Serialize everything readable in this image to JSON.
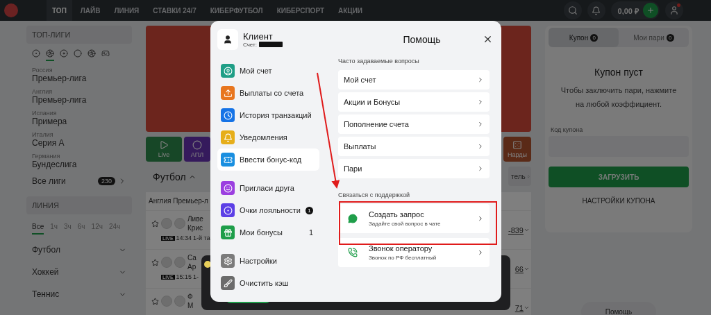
{
  "nav": {
    "items": [
      {
        "label": "ТОП",
        "selected": true
      },
      {
        "label": "ЛАЙВ",
        "selected": false
      },
      {
        "label": "ЛИНИЯ",
        "selected": false
      },
      {
        "label": "СТАВКИ 24/7",
        "selected": false
      },
      {
        "label": "КИБЕРФУТБОЛ",
        "selected": false
      },
      {
        "label": "КИБЕРСПОРТ",
        "selected": false
      },
      {
        "label": "АКЦИИ",
        "selected": false
      }
    ],
    "balance": "0,00 ₽"
  },
  "sidebar": {
    "top_leagues": {
      "title": "ТОП-ЛИГИ",
      "sports": [
        {
          "selected": false
        },
        {
          "selected": true
        },
        {
          "selected": false
        },
        {
          "selected": false
        },
        {
          "selected": false
        },
        {
          "selected": false
        }
      ],
      "leagues": [
        {
          "country": "Россия",
          "name": "Премьер-лига"
        },
        {
          "country": "Англия",
          "name": "Премьер-лига"
        },
        {
          "country": "Испания",
          "name": "Примера"
        },
        {
          "country": "Италия",
          "name": "Серия А"
        },
        {
          "country": "Германия",
          "name": "Бундеслига"
        }
      ],
      "all_leagues": {
        "label": "Все лиги",
        "count": "230"
      }
    },
    "line": {
      "title": "ЛИНИЯ",
      "periods": [
        {
          "label": "Все",
          "selected": true
        },
        {
          "label": "1ч",
          "selected": false
        },
        {
          "label": "3ч",
          "selected": false
        },
        {
          "label": "6ч",
          "selected": false
        },
        {
          "label": "12ч",
          "selected": false
        },
        {
          "label": "24ч",
          "selected": false
        }
      ],
      "sports": [
        "Футбол",
        "Хоккей",
        "Теннис"
      ]
    }
  },
  "center": {
    "tiles": [
      {
        "label": "Live"
      },
      {
        "label": "АПЛ"
      }
    ],
    "right_tile": "Нарды",
    "section_title": "Футбол",
    "league": "Англия Премьер-л",
    "sort": "тель",
    "matches": [
      {
        "team_1": "Ливе",
        "team_2": "Крис",
        "live": "LIVE",
        "time": "14:34",
        "status": "1-й та",
        "odds": "-839"
      },
      {
        "team_1": "Са",
        "team_2": "Ар",
        "live": "LIVE",
        "time": "15:15",
        "status": "1-",
        "odds": "66"
      },
      {
        "team_1": "Ф",
        "team_2": "М",
        "odds": "71"
      }
    ]
  },
  "coupon": {
    "tabs": [
      {
        "label": "Купон",
        "count": "0",
        "selected": true
      },
      {
        "label": "Мои пари",
        "count": "0",
        "selected": false
      }
    ],
    "empty_title": "Купон пуст",
    "empty_text": "Чтобы заключить пари, нажмите на любой коэффициент.",
    "code_label": "Код купона",
    "load_button": "ЗАГРУЗИТЬ",
    "settings_link": "НАСТРОЙКИ КУПОНА",
    "help_button": "Помощь"
  },
  "modal": {
    "user": {
      "name": "Клиент",
      "account_label": "Счет:"
    },
    "title": "Помощь",
    "menu_groups": [
      [
        {
          "label": "Мой счет",
          "color": "#1f9e86",
          "selected": false
        },
        {
          "label": "Выплаты со счета",
          "color": "#e8761f",
          "selected": false
        },
        {
          "label": "История транзакций",
          "color": "#1673e6",
          "selected": false
        },
        {
          "label": "Уведомления",
          "color": "#e6ae1a",
          "selected": false
        },
        {
          "label": "Ввести бонус-код",
          "color": "#1a8fe0",
          "selected": true
        }
      ],
      [
        {
          "label": "Пригласи друга",
          "color": "#9b3fe0",
          "selected": false
        },
        {
          "label": "Очки лояльности",
          "color": "#5b3fe6",
          "selected": false,
          "badge": "1"
        },
        {
          "label": "Мои бонусы",
          "color": "#1e9e4a",
          "selected": false,
          "count": "1"
        }
      ],
      [
        {
          "label": "Настройки",
          "color": "#7b7b7b",
          "selected": false
        },
        {
          "label": "Очистить кэш",
          "color": "#6b6b6b",
          "selected": false
        }
      ]
    ],
    "faq_title": "Часто задаваемые вопросы",
    "faq": [
      "Мой счет",
      "Акции и Бонусы",
      "Пополнение счета",
      "Выплаты",
      "Пари"
    ],
    "support_title": "Связаться с поддержкой",
    "support": [
      {
        "kind": "chat",
        "title": "Создать запрос",
        "subtitle": "Задайте свой вопрос в чате"
      },
      {
        "kind": "phone",
        "title": "Звонок оператору",
        "subtitle": "Звонок по РФ бесплатный"
      }
    ]
  }
}
